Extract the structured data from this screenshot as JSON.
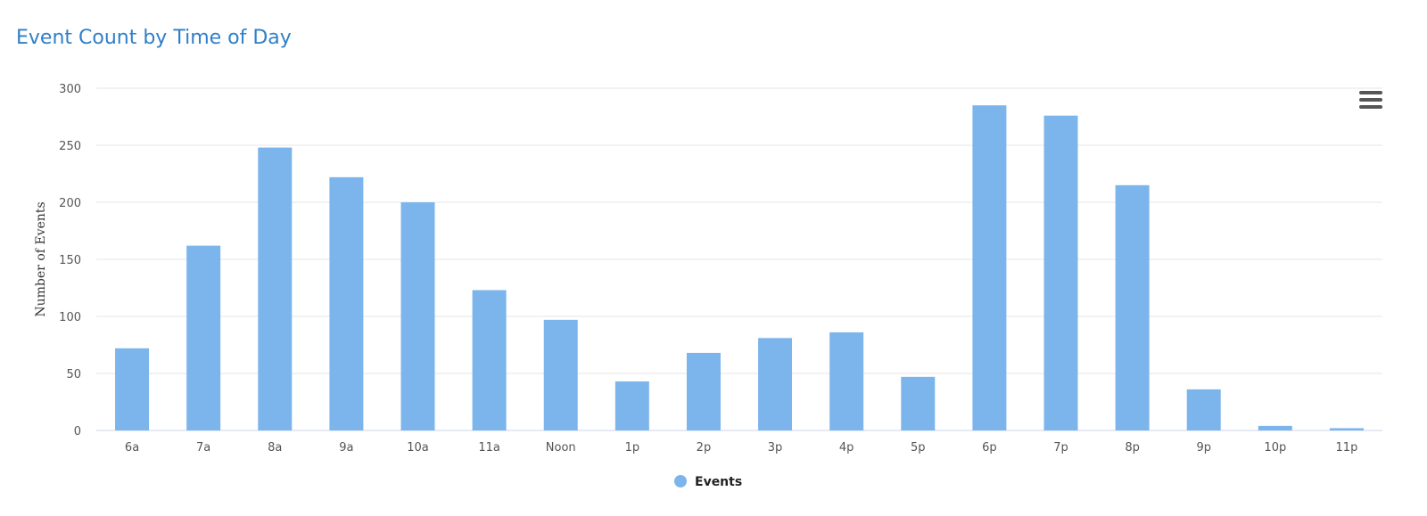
{
  "title": "Event Count by Time of Day",
  "menu_icon": "hamburger-menu-icon",
  "chart_data": {
    "type": "bar",
    "title": "Event Count by Time of Day",
    "xlabel": "",
    "ylabel": "Number of Events",
    "ylim": [
      0,
      300
    ],
    "yticks": [
      0,
      50,
      100,
      150,
      200,
      250,
      300
    ],
    "categories": [
      "6a",
      "7a",
      "8a",
      "9a",
      "10a",
      "11a",
      "Noon",
      "1p",
      "2p",
      "3p",
      "4p",
      "5p",
      "6p",
      "7p",
      "8p",
      "9p",
      "10p",
      "11p"
    ],
    "series": [
      {
        "name": "Events",
        "color": "#7cb5ec",
        "values": [
          72,
          162,
          248,
          222,
          200,
          123,
          97,
          43,
          68,
          81,
          86,
          47,
          285,
          276,
          215,
          36,
          4,
          2
        ]
      }
    ],
    "grid": true,
    "legend": "bottom-center"
  }
}
